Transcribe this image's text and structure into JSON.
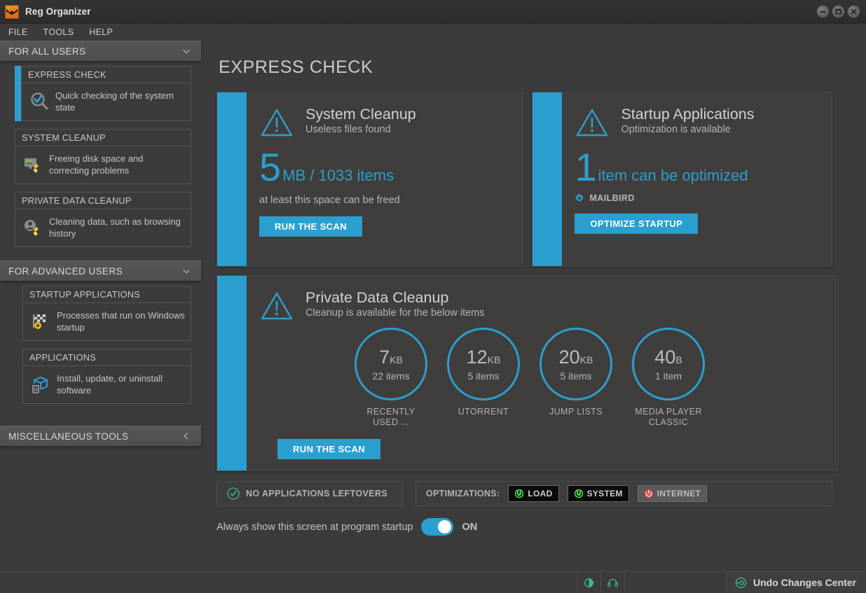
{
  "window": {
    "title": "Reg Organizer",
    "logo_icon": "reg-organizer-logo",
    "controls": [
      {
        "name": "minimize-button",
        "icon": "minimize-icon"
      },
      {
        "name": "maximize-button",
        "icon": "maximize-icon"
      },
      {
        "name": "close-button",
        "icon": "close-icon"
      }
    ]
  },
  "menubar": {
    "items": [
      {
        "label": "FILE"
      },
      {
        "label": "TOOLS"
      },
      {
        "label": "HELP"
      }
    ]
  },
  "sidebar": {
    "groups": [
      {
        "header": "FOR ALL USERS",
        "chevron": "chevron-down-icon",
        "expanded": true,
        "items": [
          {
            "title": "EXPRESS CHECK",
            "description": "Quick checking of the system state",
            "icon": "magnifier-check-icon",
            "selected": true
          },
          {
            "title": "SYSTEM CLEANUP",
            "description": "Freeing disk space and correcting problems",
            "icon": "monitor-broom-icon",
            "selected": false
          },
          {
            "title": "PRIVATE DATA CLEANUP",
            "description": "Cleaning data, such as browsing history",
            "icon": "user-broom-icon",
            "selected": false
          }
        ]
      },
      {
        "header": "FOR ADVANCED USERS",
        "chevron": "chevron-down-icon",
        "expanded": true,
        "items": [
          {
            "title": "STARTUP APPLICATIONS",
            "description": "Processes that run on Windows startup",
            "icon": "flag-gear-icon",
            "selected": false
          },
          {
            "title": "APPLICATIONS",
            "description": "Install, update, or uninstall software",
            "icon": "box-trash-icon",
            "selected": false
          }
        ]
      },
      {
        "header": "MISCELLANEOUS TOOLS",
        "chevron": "chevron-left-icon",
        "expanded": false,
        "items": []
      }
    ]
  },
  "main": {
    "page_title": "EXPRESS CHECK",
    "cards": {
      "system_cleanup": {
        "icon": "warning-triangle-icon",
        "title": "System Cleanup",
        "subtitle": "Useless files found",
        "metric_big": "5",
        "metric_rest": "MB / 1033 items",
        "note": "at least this space can be freed",
        "button": "RUN THE SCAN"
      },
      "startup_applications": {
        "icon": "warning-triangle-icon",
        "title": "Startup Applications",
        "subtitle": "Optimization is available",
        "metric_big": "1",
        "metric_rest": "item can be optimized",
        "app_icon": "gear-icon",
        "app_name": "MAILBIRD",
        "button": "OPTIMIZE STARTUP"
      },
      "private_data_cleanup": {
        "icon": "warning-triangle-icon",
        "title": "Private Data Cleanup",
        "subtitle": "Cleanup is available for the below items",
        "button": "RUN THE SCAN",
        "circles": [
          {
            "value": "7",
            "unit": "KB",
            "count": "22 items",
            "label": "RECENTLY USED ..."
          },
          {
            "value": "12",
            "unit": "KB",
            "count": "5 items",
            "label": "UTORRENT"
          },
          {
            "value": "20",
            "unit": "KB",
            "count": "5 items",
            "label": "JUMP LISTS"
          },
          {
            "value": "40",
            "unit": "B",
            "count": "1 item",
            "label": "MEDIA PLAYER CLASSIC"
          }
        ]
      }
    },
    "leftovers": {
      "icon": "check-circle-icon",
      "label": "NO APPLICATIONS LEFTOVERS"
    },
    "optimizations": {
      "label": "OPTIMIZATIONS:",
      "badges": [
        {
          "label": "LOAD",
          "state": "on",
          "icon": "power-icon",
          "color": "#4fcf4f"
        },
        {
          "label": "SYSTEM",
          "state": "on",
          "icon": "power-icon",
          "color": "#4fcf4f"
        },
        {
          "label": "INTERNET",
          "state": "off",
          "icon": "power-icon",
          "color": "#e03c3c"
        }
      ]
    },
    "startup_toggle": {
      "label": "Always show this screen at program startup",
      "state": "ON",
      "enabled": true
    }
  },
  "statusbar": {
    "icons": [
      {
        "name": "contrast-icon"
      },
      {
        "name": "support-headset-icon"
      }
    ],
    "undo": {
      "icon": "undo-circle-icon",
      "label": "Undo Changes Center"
    }
  },
  "colors": {
    "accent": "#2a9fd0",
    "window_bg": "#3b3b3b",
    "card_bg": "#403e3c",
    "green": "#3bbd8c",
    "red": "#e03c3c"
  }
}
